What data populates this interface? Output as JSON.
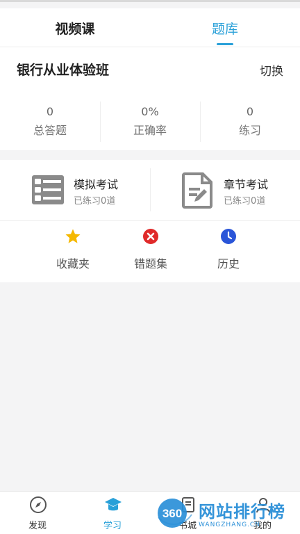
{
  "tabs": [
    {
      "label": "视频课"
    },
    {
      "label": "题库"
    }
  ],
  "course": {
    "title": "银行从业体验班",
    "switch_label": "切换"
  },
  "stats": [
    {
      "value": "0",
      "label": "总答题"
    },
    {
      "value": "0%",
      "label": "正确率"
    },
    {
      "value": "0",
      "label": "练习"
    }
  ],
  "exams": [
    {
      "title": "模拟考试",
      "subtitle": "已练习0道",
      "icon": "exam-list-icon"
    },
    {
      "title": "章节考试",
      "subtitle": "已练习0道",
      "icon": "document-edit-icon"
    }
  ],
  "tools": [
    {
      "label": "收藏夹",
      "icon": "star-icon",
      "color": "#f5b800"
    },
    {
      "label": "错题集",
      "icon": "error-icon",
      "color": "#e02a2a"
    },
    {
      "label": "历史",
      "icon": "clock-icon",
      "color": "#2a55d8"
    }
  ],
  "nav": [
    {
      "label": "发现",
      "icon": "compass-icon"
    },
    {
      "label": "学习",
      "icon": "graduation-cap-icon"
    },
    {
      "label": "书城",
      "icon": "book-icon"
    },
    {
      "label": "我的",
      "icon": "user-icon"
    }
  ],
  "watermark": {
    "badge": "360",
    "text": "网站排行榜",
    "sub": "WANGZHANG.CN"
  },
  "colors": {
    "accent": "#29a0d8",
    "background": "#f4f4f5"
  }
}
